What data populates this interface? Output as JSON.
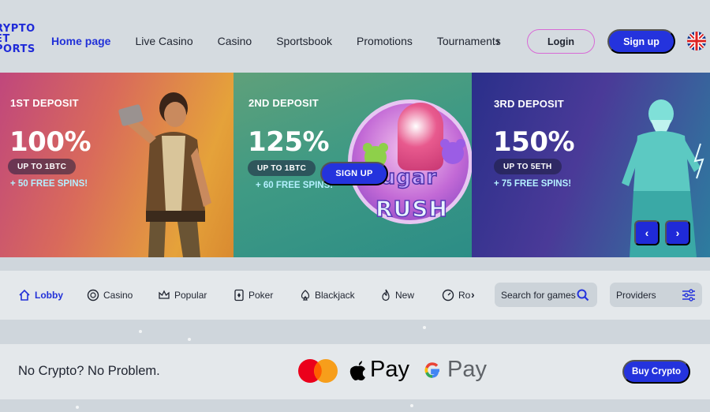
{
  "header": {
    "logo_lines": [
      "RYPTO",
      "ET",
      "PORTS"
    ],
    "nav": [
      "Home page",
      "Live Casino",
      "Casino",
      "Sportsbook",
      "Promotions",
      "Tournaments"
    ],
    "more_glyph": "›",
    "login_label": "Login",
    "signup_label": "Sign up",
    "language_flag": "uk-flag-icon"
  },
  "banners": [
    {
      "label": "1ST DEPOSIT",
      "percent": "100%",
      "pill": "UP TO 1BTC",
      "spins": "+ 50 FREE SPINS!"
    },
    {
      "label": "2ND DEPOSIT",
      "percent": "125%",
      "pill": "UP TO 1BTC",
      "spins": "+ 60 FREE SPINS!",
      "cta": "SIGN UP",
      "game_title_1": "Sugar",
      "game_title_2": "RUSH"
    },
    {
      "label": "3RD DEPOSIT",
      "percent": "150%",
      "pill": "UP TO 5ETH",
      "spins": "+ 75 FREE SPINS!"
    }
  ],
  "slider": {
    "prev": "‹",
    "next": "›"
  },
  "categories": {
    "items": [
      {
        "label": "Lobby",
        "icon": "home-icon",
        "active": true
      },
      {
        "label": "Casino",
        "icon": "chip-icon"
      },
      {
        "label": "Popular",
        "icon": "crown-icon"
      },
      {
        "label": "Poker",
        "icon": "card-icon"
      },
      {
        "label": "Blackjack",
        "icon": "spade-icon"
      },
      {
        "label": "New",
        "icon": "flame-icon"
      },
      {
        "label": "Ro",
        "icon": "roulette-icon"
      }
    ],
    "more_glyph": "›",
    "search_placeholder": "Search for games",
    "providers_label": "Providers"
  },
  "crypto": {
    "text": "No Crypto? No Problem.",
    "apple_pay": "Pay",
    "google_pay": "Pay",
    "buy_label": "Buy Crypto"
  },
  "colors": {
    "accent": "#2433dd",
    "login_border": "#d86ad6"
  }
}
